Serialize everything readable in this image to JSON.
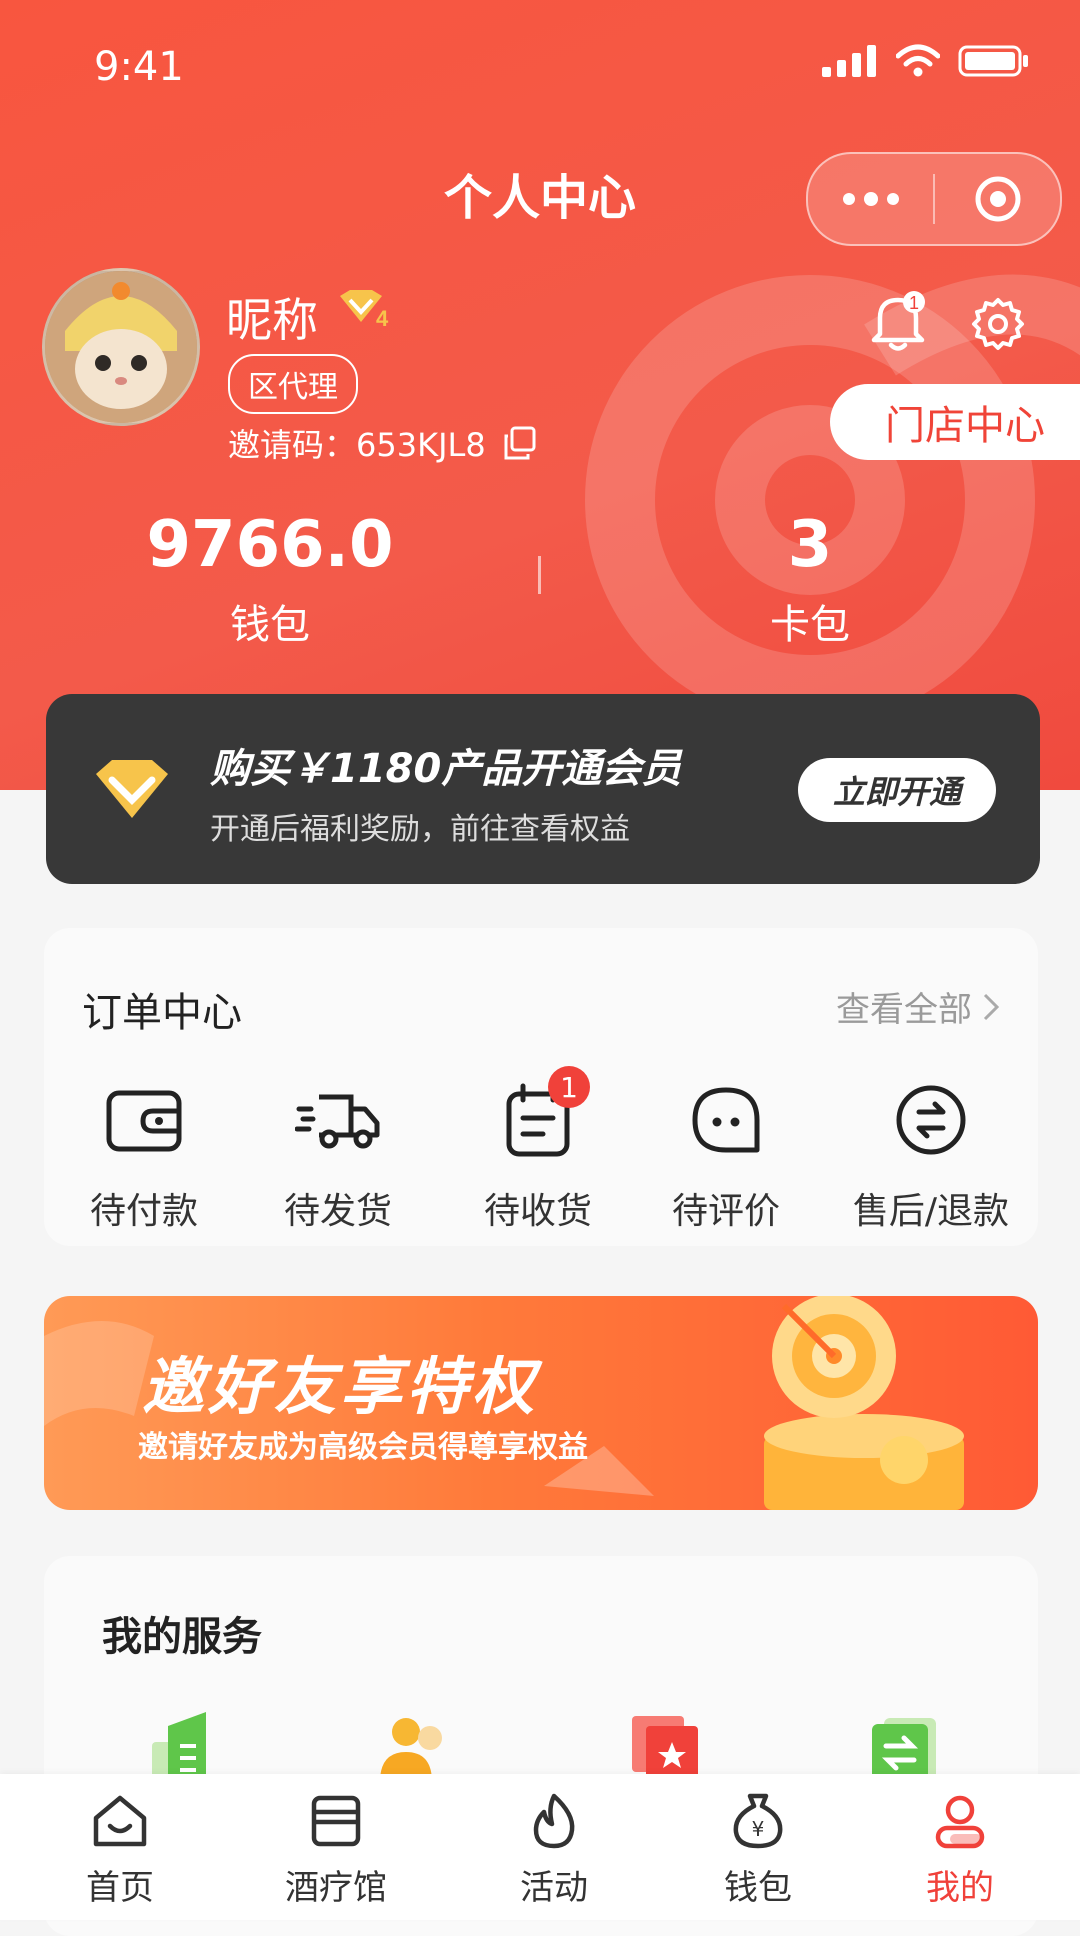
{
  "status": {
    "time": "9:41"
  },
  "nav": {
    "title": "个人中心"
  },
  "profile": {
    "nickname": "昵称",
    "vip_level": "4",
    "role": "区代理",
    "invite_label": "邀请码：653KJL8",
    "store_button": "门店中心",
    "notification_count": "1"
  },
  "stats": {
    "wallet_value": "9766.0",
    "wallet_label": "钱包",
    "cards_value": "3",
    "cards_label": "卡包"
  },
  "member": {
    "title": "购买￥1180产品开通会员",
    "subtitle": "开通后福利奖励，前往查看权益",
    "button": "立即开通"
  },
  "orders": {
    "title": "订单中心",
    "view_all": "查看全部",
    "items": [
      {
        "label": "待付款",
        "icon": "wallet-icon"
      },
      {
        "label": "待发货",
        "icon": "truck-icon"
      },
      {
        "label": "待收货",
        "icon": "calendar-icon",
        "badge": "1"
      },
      {
        "label": "待评价",
        "icon": "chat-bubble-icon"
      },
      {
        "label": "售后/退款",
        "icon": "refund-icon"
      }
    ]
  },
  "invite_banner": {
    "title": "邀好友享特权",
    "subtitle": "邀请好友成为高级会员得尊享权益"
  },
  "services": {
    "title": "我的服务"
  },
  "tabbar": {
    "items": [
      {
        "label": "首页",
        "icon": "home-icon"
      },
      {
        "label": "酒疗馆",
        "icon": "store-icon"
      },
      {
        "label": "活动",
        "icon": "flame-icon"
      },
      {
        "label": "钱包",
        "icon": "money-bag-icon"
      },
      {
        "label": "我的",
        "icon": "user-icon",
        "active": true
      }
    ]
  },
  "colors": {
    "accent": "#f0413a",
    "dark_card": "#383838"
  }
}
